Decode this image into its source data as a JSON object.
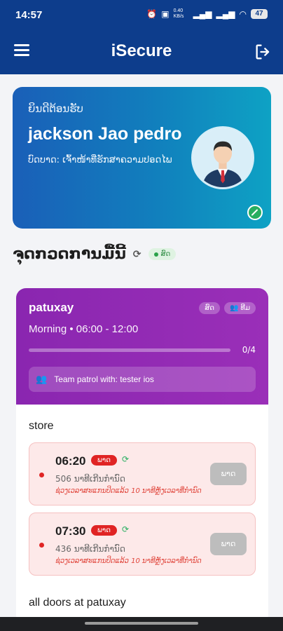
{
  "status_bar": {
    "time": "14:57",
    "net_speed": "0.40 KB/s",
    "signal1": "⁴ᴳ",
    "signal2": "⁴ᴳ",
    "battery": "47"
  },
  "app_bar": {
    "title": "iSecure",
    "menu_icon": "hamburger-menu-icon",
    "logout_icon": "logout-icon"
  },
  "welcome": {
    "greeting": "ຍິນດີຕ້ອນຮັບ",
    "name": "jackson Jao pedro",
    "role": "ບົດບາດ: ເຈົ້າໜ້າທີ່ຮັກສາຄວາມປອດໄພ",
    "avatar_icon": "user-avatar-icon",
    "status_icon": "edit-check-icon"
  },
  "today": {
    "title": "ຈຸດກວດການມື້ນີ້",
    "refresh_icon": "refresh-icon",
    "status_chip": "ສົດ"
  },
  "shift_card": {
    "location": "patuxay",
    "tag_live": "ສົດ",
    "tag_team": "ທີມ",
    "shift": "Morning • 06:00 - 12:00",
    "progress_text": "0/4",
    "progress_fraction": 0,
    "team_text": "Team patrol with: tester ios",
    "groups": [
      {
        "label": "store",
        "checkpoints": [
          {
            "time": "06:20",
            "badge": "ພາດ",
            "overtime": "506 ນາທີເກີນກຳນົດ",
            "note": "ຊ່ວງເວລາສະແກນປິດແລ້ວ 10 ນາທີຫຼັງເວລາທີ່ກຳນົດ",
            "action": "ພາດ"
          },
          {
            "time": "07:30",
            "badge": "ພາດ",
            "overtime": "436 ນາທີເກີນກຳນົດ",
            "note": "ຊ່ວງເວລາສະແກນປິດແລ້ວ 10 ນາທີຫຼັງເວລາທີ່ກຳນົດ",
            "action": "ພາດ"
          }
        ]
      },
      {
        "label": "all doors at patuxay"
      }
    ]
  },
  "colors": {
    "primary": "#0d3d8c",
    "card_purple": "#8a26b0",
    "missed_red": "#e02424",
    "success_green": "#27ae60"
  }
}
